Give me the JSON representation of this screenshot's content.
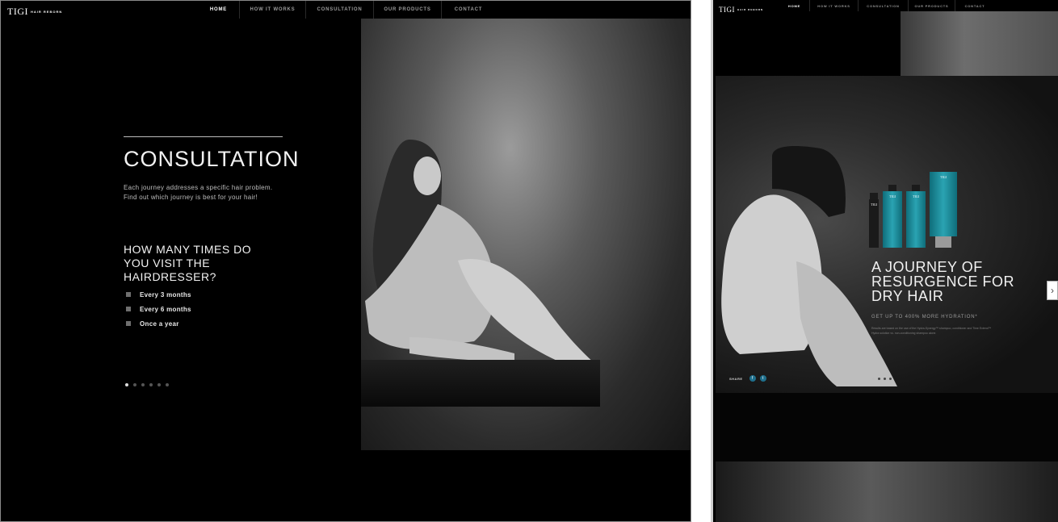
{
  "left_screen": {
    "logo": {
      "main": "TIGI",
      "sub": "HAIR REBORN"
    },
    "nav": [
      {
        "label": "HOME",
        "active": true
      },
      {
        "label": "HOW IT WORKS",
        "active": false
      },
      {
        "label": "CONSULTATION",
        "active": false
      },
      {
        "label": "OUR PRODUCTS",
        "active": false
      },
      {
        "label": "CONTACT",
        "active": false
      }
    ],
    "heading": "CONSULTATION",
    "description": "Each journey addresses a specific hair problem. Find out which journey is best for your hair!",
    "question": "HOW MANY TIMES DO YOU VISIT THE HAIRDRESSER?",
    "options": [
      "Every 3 months",
      "Every 6 months",
      "Once a year"
    ],
    "pagination_count": 6,
    "pagination_active": 1
  },
  "right_screen": {
    "logo": {
      "main": "TIGI",
      "sub": "HAIR REBORN"
    },
    "nav": [
      {
        "label": "HOME",
        "active": true
      },
      {
        "label": "HOW IT WORKS",
        "active": false
      },
      {
        "label": "CONSULTATION",
        "active": false
      },
      {
        "label": "OUR PRODUCTS",
        "active": false
      },
      {
        "label": "CONTACT",
        "active": false
      }
    ],
    "product_brand": "TIGI",
    "journey_title": "A JOURNEY OF RESURGENCE FOR DRY HAIR",
    "hydration": "GET UP TO 400% MORE HYDRATION*",
    "fine_print": "Results are based on the use of the Hydra-Synergy™ shampoo, conditioner and Time Extend™ Hydra solution vs. non-conditioning shampoo alone.",
    "share_label": "SHARE",
    "social_icons": [
      "facebook-icon",
      "twitter-icon"
    ],
    "pagination_count": 4,
    "pagination_active": 1,
    "next_arrow": "›"
  },
  "colors": {
    "background": "#000000",
    "teal_product": "#2aa3b2",
    "social": "#1f6f8c"
  }
}
